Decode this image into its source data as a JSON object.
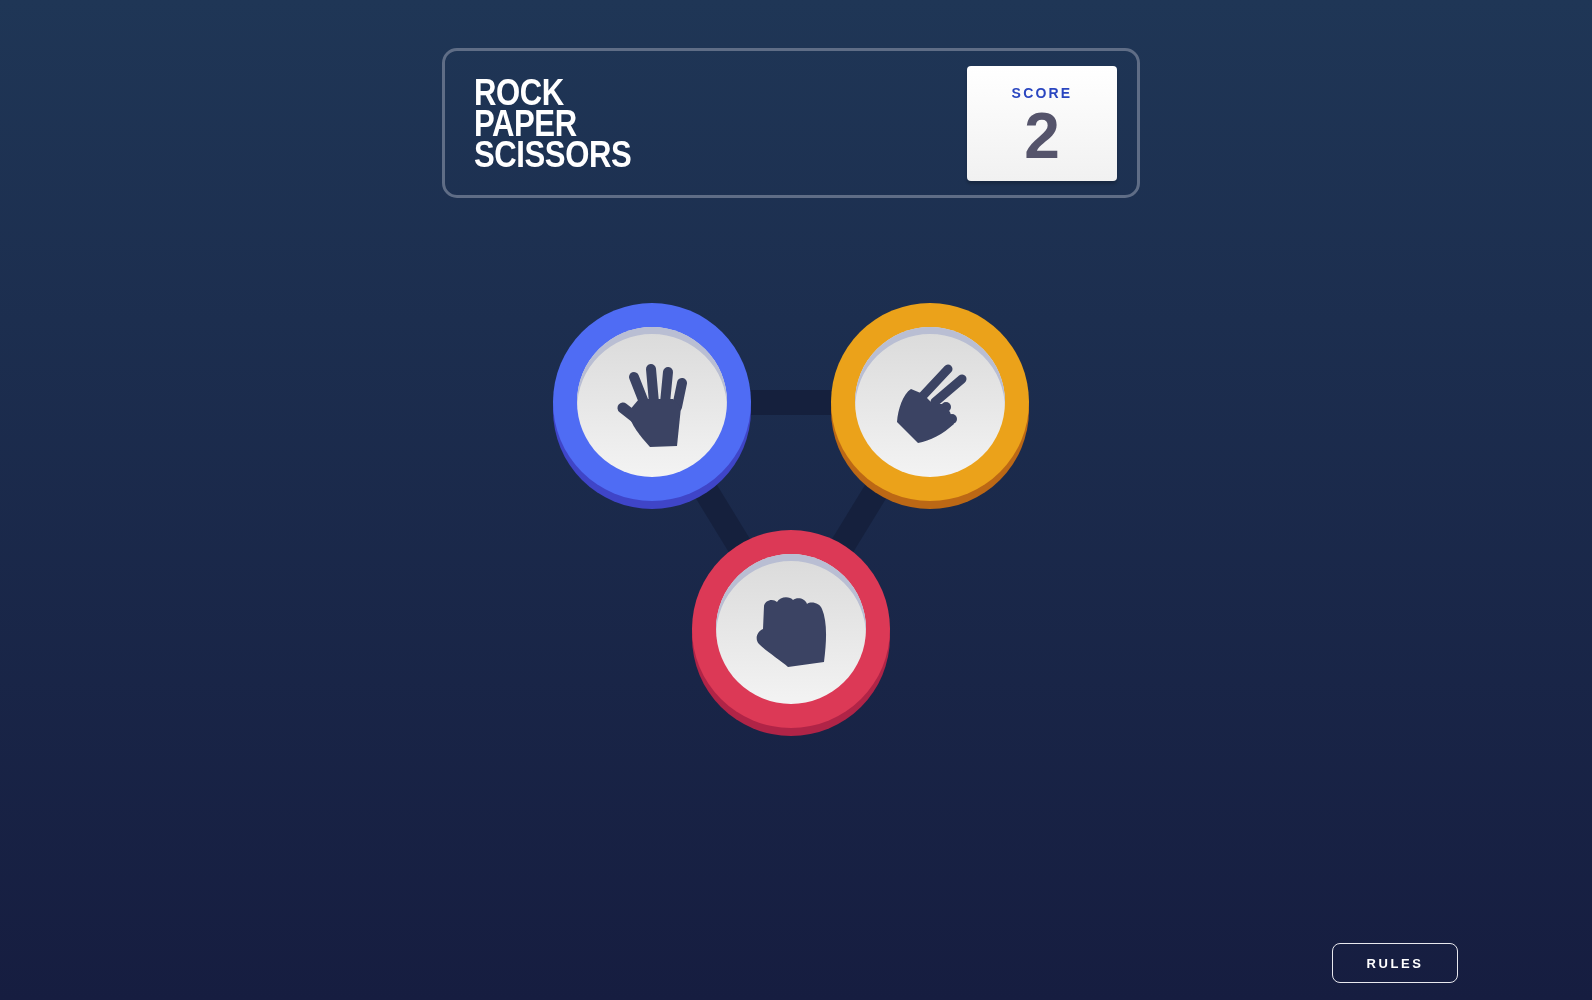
{
  "header": {
    "title": "ROCK PAPER SCISSORS",
    "score": {
      "label": "SCORE",
      "value": "2"
    }
  },
  "choices": [
    {
      "kind": "paper",
      "color": "#4f6cf4"
    },
    {
      "kind": "scissors",
      "color": "#eba21a"
    },
    {
      "kind": "rock",
      "color": "#dc3956"
    }
  ],
  "rules_button": {
    "label": "RULES"
  }
}
